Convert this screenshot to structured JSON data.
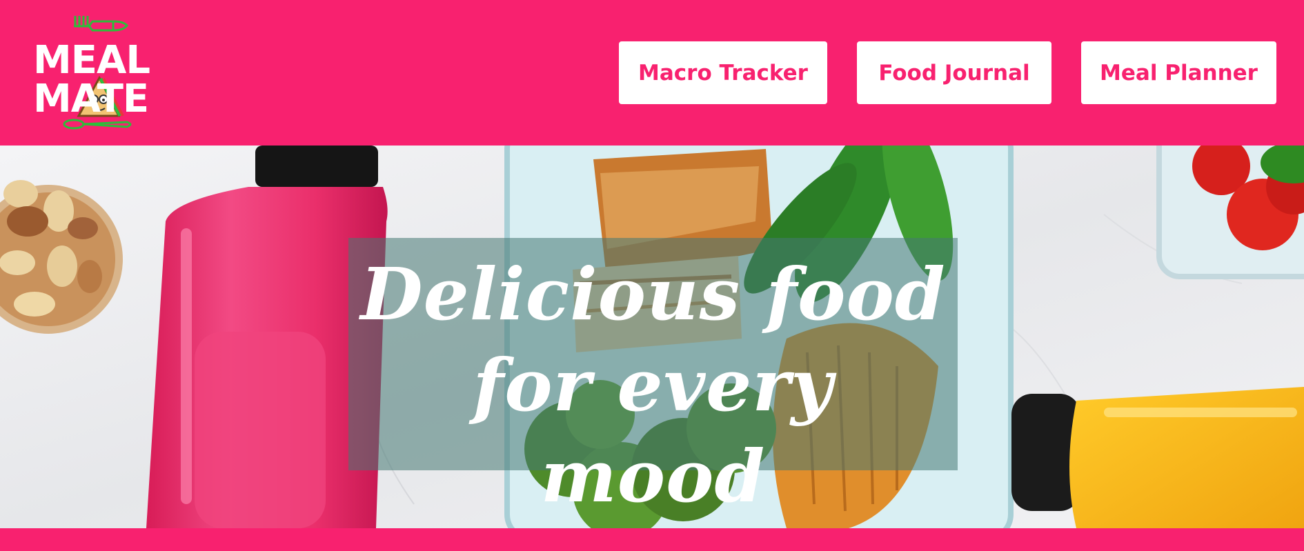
{
  "brand": {
    "name_line1": "MEAL",
    "name_line2": "MATE",
    "icons": [
      "fork-icon",
      "spoon-icon",
      "sandwich-mascot-icon"
    ],
    "colors": {
      "primary": "#f8216f",
      "accent": "#2dbd3a",
      "white": "#ffffff"
    }
  },
  "nav": {
    "items": [
      {
        "label": "Macro Tracker"
      },
      {
        "label": "Food Journal"
      },
      {
        "label": "Meal Planner"
      }
    ]
  },
  "hero": {
    "headline_line1": "Delicious food",
    "headline_line2": "for every mood"
  }
}
